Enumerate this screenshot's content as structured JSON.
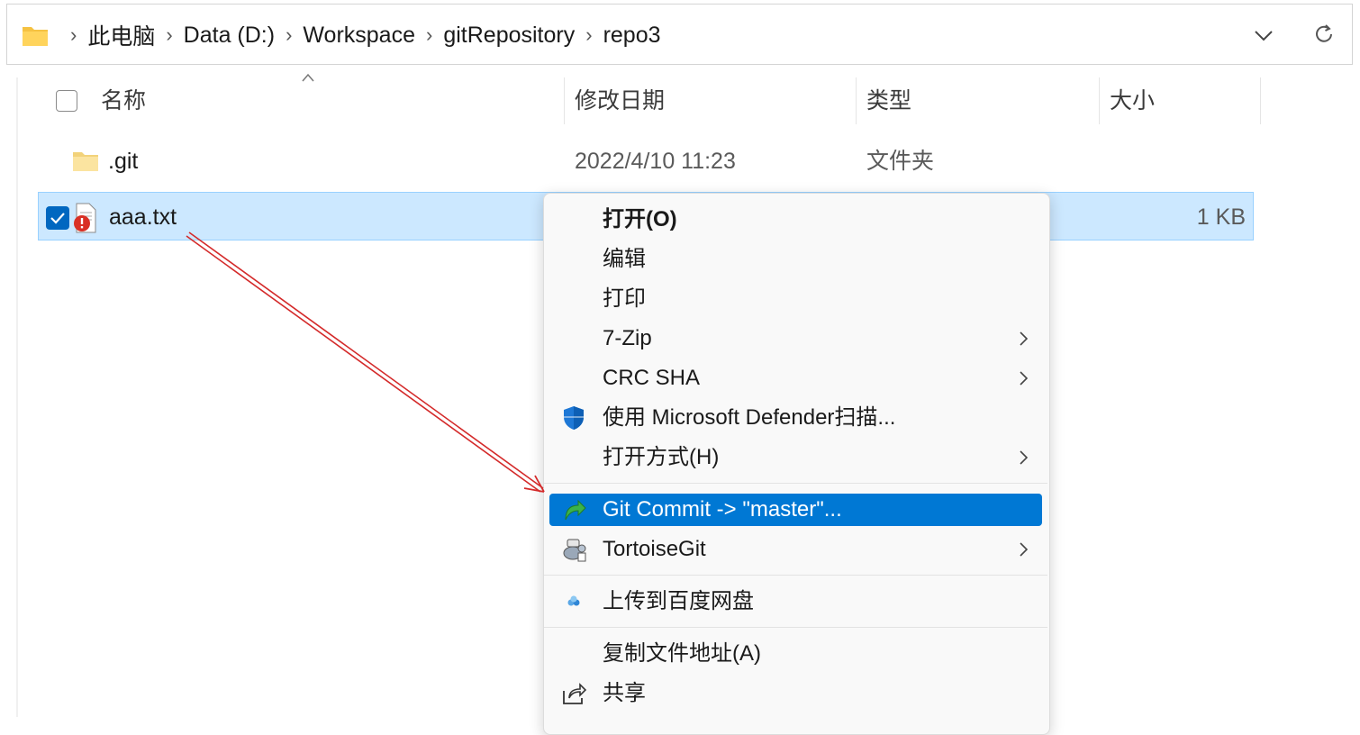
{
  "address_bar": {
    "breadcrumbs": [
      "此电脑",
      "Data (D:)",
      "Workspace",
      "gitRepository",
      "repo3"
    ],
    "folder_icon": "folder-icon",
    "dropdown_icon": "chevron-down-icon",
    "refresh_icon": "refresh-icon"
  },
  "columns": {
    "name": "名称",
    "modified": "修改日期",
    "type": "类型",
    "size": "大小"
  },
  "files": [
    {
      "name": ".git",
      "modified": "2022/4/10 11:23",
      "type": "文件夹",
      "size": "",
      "icon": "folder-icon",
      "selected": false
    },
    {
      "name": "aaa.txt",
      "modified": "",
      "type": "",
      "size": "1 KB",
      "icon": "text-file-conflict-icon",
      "selected": true
    }
  ],
  "context_menu": {
    "items": [
      {
        "label": "打开(O)",
        "bold": true
      },
      {
        "label": "编辑"
      },
      {
        "label": "打印"
      },
      {
        "label": "7-Zip",
        "submenu": true
      },
      {
        "label": "CRC SHA",
        "submenu": true
      },
      {
        "label": "使用 Microsoft Defender扫描...",
        "icon": "defender-shield-icon"
      },
      {
        "label": "打开方式(H)",
        "submenu": true
      },
      {
        "label": "Git Commit -> \"master\"...",
        "icon": "git-commit-icon",
        "highlighted": true
      },
      {
        "label": "TortoiseGit",
        "icon": "tortoisegit-icon",
        "submenu": true
      },
      {
        "label": "上传到百度网盘",
        "icon": "baidu-netdisk-icon"
      },
      {
        "label": "复制文件地址(A)"
      },
      {
        "label": "共享",
        "icon": "share-icon"
      }
    ]
  },
  "colors": {
    "selection_bg": "#cce8ff",
    "menu_highlight": "#0078d4",
    "annotation_arrow": "#d42a2a"
  }
}
